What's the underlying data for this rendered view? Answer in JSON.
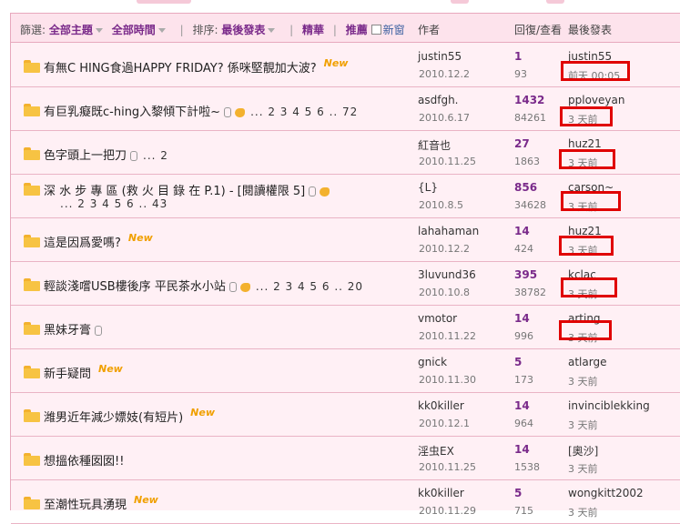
{
  "header": {
    "filter_label": "篩選:",
    "topic_filter": "全部主題",
    "time_filter": "全部時間",
    "sort_label": "排序:",
    "sort_value": "最後發表",
    "digest": "精華",
    "recommended": "推薦",
    "new_window": "新窗",
    "col_author": "作者",
    "col_replies": "回復/查看",
    "col_last": "最後發表"
  },
  "rows": [
    {
      "title": "有無C HING食過HAPPY FRIDAY? 係咪堅靚加大波?",
      "new": "New",
      "author": "justin55",
      "date": "2010.12.2",
      "replies": "1",
      "views": "93",
      "last_user": "justin55",
      "last_time": "前天 00:05"
    },
    {
      "title": "有巨乳癡既c-hing入黎傾下計啦~",
      "pages": "... 2 3 4 5 6 .. 72",
      "author": "asdfgh.",
      "date": "2010.6.17",
      "replies": "1432",
      "views": "84261",
      "last_user": "pploveyan",
      "last_time": "3 天前"
    },
    {
      "title": "色字頭上一把刀",
      "pages": "... 2",
      "author": "紅音也",
      "date": "2010.11.25",
      "replies": "27",
      "views": "1863",
      "last_user": "huz21",
      "last_time": "3 天前"
    },
    {
      "title": "深 水 步 專 區 (救 火 目 錄 在 P.1) - [閱讀權限 5]",
      "pages": "... 2 3 4 5 6 .. 43",
      "author": "{L}",
      "date": "2010.8.5",
      "replies": "856",
      "views": "34628",
      "last_user": "carson~",
      "last_time": "3 天前"
    },
    {
      "title": "這是因爲愛嗎?",
      "new": "New",
      "author": "lahahaman",
      "date": "2010.12.2",
      "replies": "14",
      "views": "424",
      "last_user": "huz21",
      "last_time": "3 天前"
    },
    {
      "title": "輕談淺嚐USB樓後序 平民茶水小站",
      "pages": "... 2 3 4 5 6 .. 20",
      "author": "3luvund36",
      "date": "2010.10.8",
      "replies": "395",
      "views": "38782",
      "last_user": "kclac",
      "last_time": "3 天前"
    },
    {
      "title": "黑妹牙膏",
      "author": "vmotor",
      "date": "2010.11.22",
      "replies": "14",
      "views": "996",
      "last_user": "arting",
      "last_time": "3 天前"
    },
    {
      "title": "新手疑問",
      "new": "New",
      "author": "gnick",
      "date": "2010.11.30",
      "replies": "5",
      "views": "173",
      "last_user": "atlarge",
      "last_time": "3 天前"
    },
    {
      "title": "潍男近年減少嫖妓(有短片)",
      "new": "New",
      "author": "kk0killer",
      "date": "2010.12.1",
      "replies": "14",
      "views": "964",
      "last_user": "invinciblekking",
      "last_time": "3 天前"
    },
    {
      "title": "想搵依種囡囡!!",
      "author": "淫虫EX",
      "date": "2010.11.25",
      "replies": "14",
      "views": "1538",
      "last_user": "[奧沙]",
      "last_time": "3 天前"
    },
    {
      "title": "至潮性玩具湧現",
      "new": "New",
      "author": "kk0killer",
      "date": "2010.11.29",
      "replies": "5",
      "views": "715",
      "last_user": "wongkitt2002",
      "last_time": "3 天前"
    }
  ],
  "colors": {
    "accent": "#7a2a8a",
    "highlight_box": "#e00000",
    "header_bg": "#fde3ec",
    "row_bg": "#fff0f5",
    "new_tag": "#f0a000"
  },
  "icons": {
    "topic": "folder-icon",
    "attachment": "paperclip-icon",
    "hot": "thumbs-up-icon"
  }
}
